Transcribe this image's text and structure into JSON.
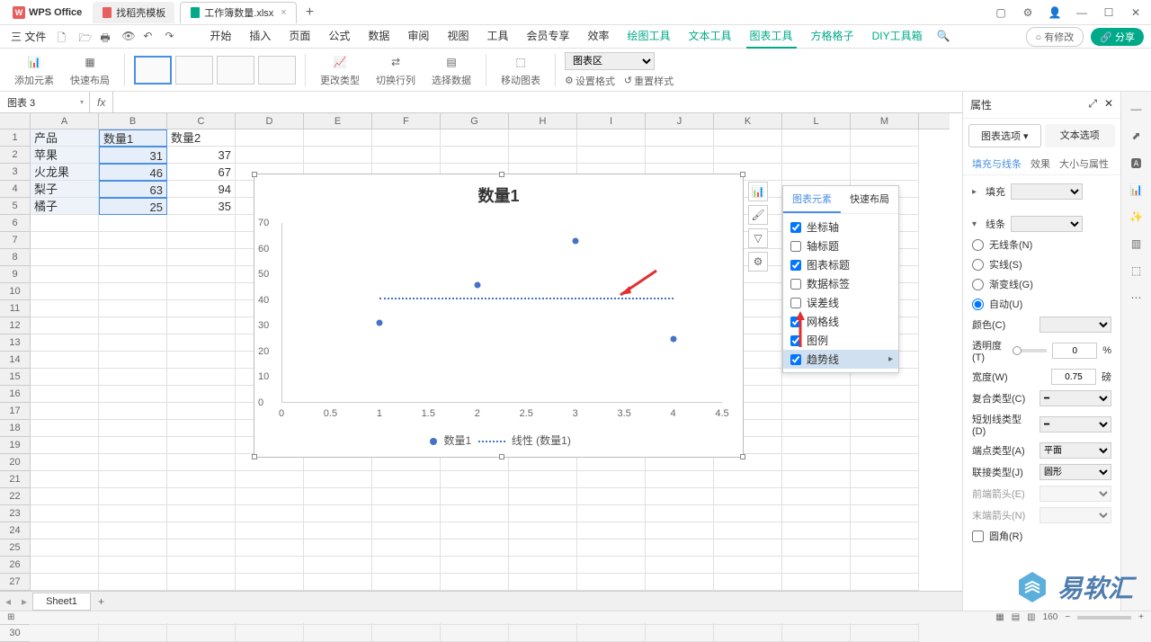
{
  "app": {
    "name": "WPS Office"
  },
  "tabs": [
    {
      "label": "找稻壳模板",
      "icon_color": "#e85d5d"
    },
    {
      "label": "工作簿数量.xlsx",
      "icon_color": "#0a8",
      "active": true
    }
  ],
  "menu": {
    "file": "三 文件",
    "items": [
      "开始",
      "插入",
      "页面",
      "公式",
      "数据",
      "审阅",
      "视图",
      "工具",
      "会员专享",
      "效率",
      "绘图工具",
      "文本工具",
      "图表工具",
      "方格格子",
      "DIY工具箱"
    ],
    "active": "图表工具",
    "green_from": 10,
    "modified": "有修改",
    "share": "分享"
  },
  "ribbon": {
    "add_element": "添加元素",
    "quick_layout": "快速布局",
    "change_type": "更改类型",
    "switch_rowcol": "切换行列",
    "select_data": "选择数据",
    "move_chart": "移动图表",
    "chart_area": "图表区",
    "format_sel": "设置格式",
    "reset_style": "重置样式"
  },
  "formula": {
    "name_box": "图表 3",
    "fx": "fx"
  },
  "sheet": {
    "cols": [
      "A",
      "B",
      "C",
      "D",
      "E",
      "F",
      "G",
      "H",
      "I",
      "J",
      "K",
      "L",
      "M"
    ],
    "data": [
      [
        "产品",
        "数量1",
        "数量2"
      ],
      [
        "苹果",
        "31",
        "37"
      ],
      [
        "火龙果",
        "46",
        "67"
      ],
      [
        "梨子",
        "63",
        "94"
      ],
      [
        "橘子",
        "25",
        "35"
      ]
    ],
    "row_count": 30,
    "sheet_name": "Sheet1"
  },
  "chart_data": {
    "type": "scatter",
    "title": "数量1",
    "x": [
      1,
      2,
      3,
      4
    ],
    "values": [
      31,
      46,
      63,
      25
    ],
    "xlim": [
      0,
      4.5
    ],
    "ylim": [
      0,
      70
    ],
    "xticks": [
      0,
      0.5,
      1,
      1.5,
      2,
      2.5,
      3,
      3.5,
      4,
      4.5
    ],
    "yticks": [
      0,
      10,
      20,
      30,
      40,
      50,
      60,
      70
    ],
    "legend": [
      "数量1",
      "线性 (数量1)"
    ],
    "trendline_y": 41
  },
  "chart_popup": {
    "tabs": [
      "图表元素",
      "快速布局"
    ],
    "active_tab": 0,
    "items": [
      {
        "label": "坐标轴",
        "checked": true
      },
      {
        "label": "轴标题",
        "checked": false
      },
      {
        "label": "图表标题",
        "checked": true
      },
      {
        "label": "数据标签",
        "checked": false
      },
      {
        "label": "误差线",
        "checked": false
      },
      {
        "label": "网格线",
        "checked": true
      },
      {
        "label": "图例",
        "checked": true
      },
      {
        "label": "趋势线",
        "checked": true,
        "hl": true,
        "arrow": true
      }
    ]
  },
  "right_panel": {
    "title": "属性",
    "tabs": [
      "图表选项",
      "文本选项"
    ],
    "subtabs": [
      "填充与线条",
      "效果",
      "大小与属性"
    ],
    "fill_label": "填充",
    "line_label": "线条",
    "line_opts": [
      "无线条(N)",
      "实线(S)",
      "渐变线(G)",
      "自动(U)"
    ],
    "line_selected": 3,
    "color": "颜色(C)",
    "opacity": "透明度(T)",
    "opacity_val": "0",
    "opacity_unit": "%",
    "width": "宽度(W)",
    "width_val": "0.75",
    "width_unit": "磅",
    "compound": "复合类型(C)",
    "dash": "短划线类型(D)",
    "cap": "端点类型(A)",
    "cap_val": "平面",
    "join": "联接类型(J)",
    "join_val": "圆形",
    "begin_arrow": "前端箭头(E)",
    "end_arrow": "末端箭头(N)",
    "round": "圆角(R)"
  },
  "status": {
    "zoom": "160",
    "view_icons": true
  }
}
